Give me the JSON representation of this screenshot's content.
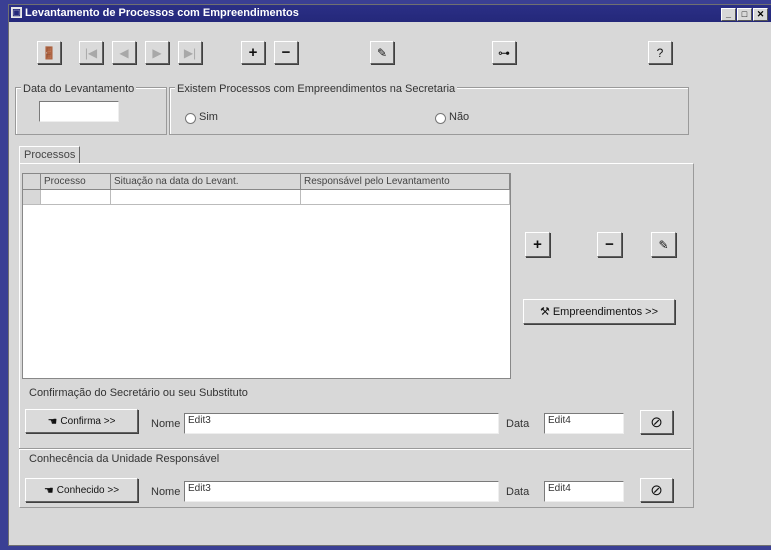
{
  "window": {
    "title": "Levantamento de Processos com Empreendimentos"
  },
  "toolbar": {
    "first": "|◀",
    "prev": "◀",
    "next": "▶",
    "last": "▶|",
    "add": "+",
    "remove": "−",
    "edit": "✎",
    "key": "⊶",
    "help": "?"
  },
  "form": {
    "date_label": "Data do Levantamento",
    "date_value": "",
    "question": "Existem Processos com Empreendimentos na Secretaria",
    "yes_label": "Sim",
    "no_label": "Não"
  },
  "tabs": [
    {
      "label": "Processos"
    }
  ],
  "grid": {
    "columns": [
      "Processo",
      "Situação na data do Levant.",
      "Responsável pelo Levantamento"
    ]
  },
  "side": {
    "add": "+",
    "remove": "−",
    "edit": "✎",
    "empreendimentos_label": "Empreendimentos >>"
  },
  "confirm": {
    "section": "Confirmação do Secretário ou seu Substituto",
    "button_label": "Confirma >>",
    "name_label": "Nome",
    "name_value": "Edit3",
    "date_label": "Data",
    "date_value": "Edit4",
    "clear_icon": "⊘"
  },
  "aware": {
    "section": "Conhecência da Unidade Responsável",
    "button_label": "Conhecido >>",
    "name_label": "Nome",
    "name_value": "Edit3",
    "date_label": "Data",
    "date_value": "Edit4",
    "clear_icon": "⊘"
  },
  "colors": {
    "title_bg": "#24287a",
    "window_bg": "#d8d8d8",
    "desktop_bg": "#3a3f94"
  }
}
